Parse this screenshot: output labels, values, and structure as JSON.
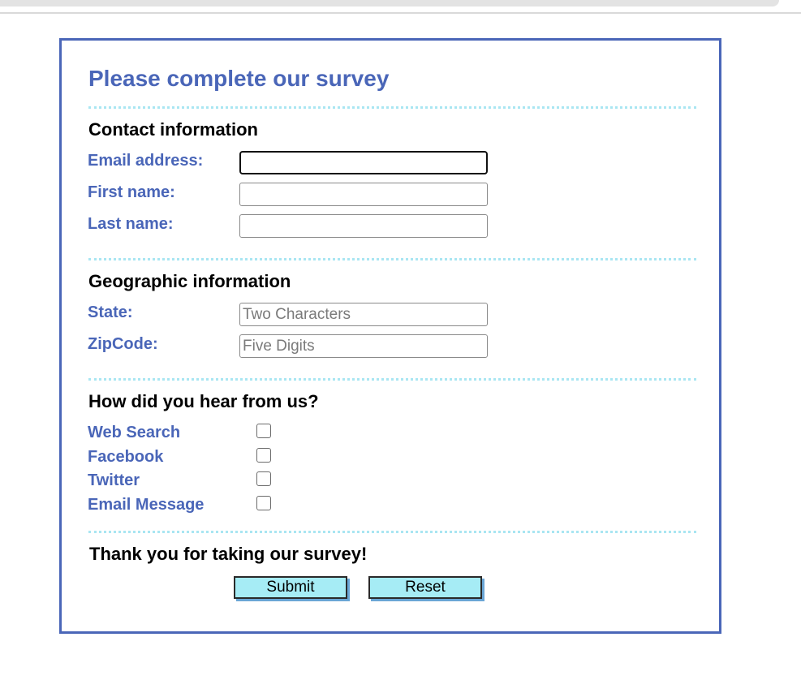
{
  "survey": {
    "title": "Please complete our survey",
    "contact": {
      "heading": "Contact information",
      "email_label": "Email address:",
      "first_name_label": "First name:",
      "last_name_label": "Last name:"
    },
    "geographic": {
      "heading": "Geographic information",
      "state_label": "State:",
      "state_placeholder": "Two Characters",
      "zip_label": "ZipCode:",
      "zip_placeholder": "Five Digits"
    },
    "referral": {
      "heading": "How did you hear from us?",
      "options": [
        {
          "label": "Web Search",
          "checked": false
        },
        {
          "label": "Facebook",
          "checked": false
        },
        {
          "label": "Twitter",
          "checked": false
        },
        {
          "label": "Email Message",
          "checked": false
        }
      ]
    },
    "closing": {
      "heading": "Thank you for taking our survey!",
      "submit_label": "Submit",
      "reset_label": "Reset"
    }
  },
  "colors": {
    "accent": "#4a66b8",
    "divider": "#a9e6f2",
    "button_fill": "#a6ecf5"
  }
}
